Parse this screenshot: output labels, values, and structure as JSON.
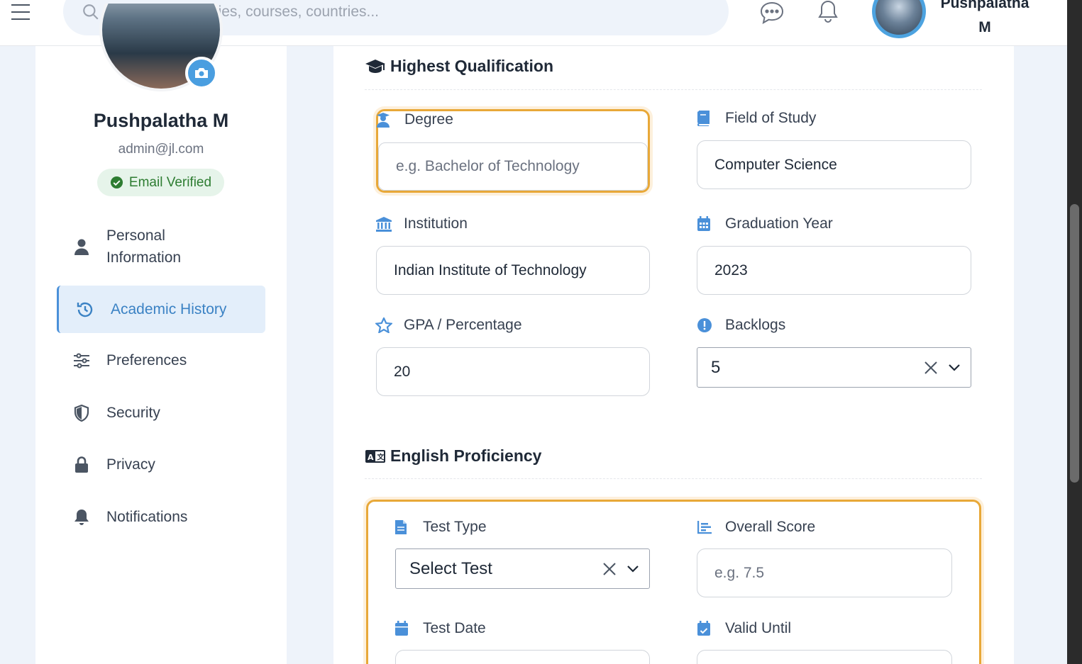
{
  "topbar": {
    "search_placeholder": "Search universities, courses, countries...",
    "user_name": "Pushpalatha M"
  },
  "profile": {
    "name": "Pushpalatha M",
    "email": "admin@jl.com",
    "verified_label": "Email Verified"
  },
  "nav": {
    "items": [
      {
        "label": "Personal Information",
        "icon": "user-icon"
      },
      {
        "label": "Academic History",
        "icon": "history-icon"
      },
      {
        "label": "Preferences",
        "icon": "sliders-icon"
      },
      {
        "label": "Security",
        "icon": "shield-icon"
      },
      {
        "label": "Privacy",
        "icon": "lock-icon"
      },
      {
        "label": "Notifications",
        "icon": "bell-icon"
      }
    ],
    "active": "Academic History"
  },
  "qualification": {
    "title": "Highest Qualification",
    "degree_label": "Degree",
    "degree_placeholder": "e.g. Bachelor of Technology",
    "field_label": "Field of Study",
    "field_value": "Computer Science",
    "institution_label": "Institution",
    "institution_value": "Indian Institute of Technology",
    "grad_year_label": "Graduation Year",
    "grad_year_value": "2023",
    "gpa_label": "GPA / Percentage",
    "gpa_value": "20",
    "backlogs_label": "Backlogs",
    "backlogs_value": "5"
  },
  "english": {
    "title": "English Proficiency",
    "test_type_label": "Test Type",
    "test_type_value": "Select Test",
    "overall_label": "Overall Score",
    "overall_placeholder": "e.g. 7.5",
    "test_date_label": "Test Date",
    "valid_until_label": "Valid Until"
  },
  "colors": {
    "accent": "#4a90d9",
    "highlight": "#e8a838",
    "verified_bg": "#e6f4ea",
    "verified_text": "#2e7d32"
  }
}
